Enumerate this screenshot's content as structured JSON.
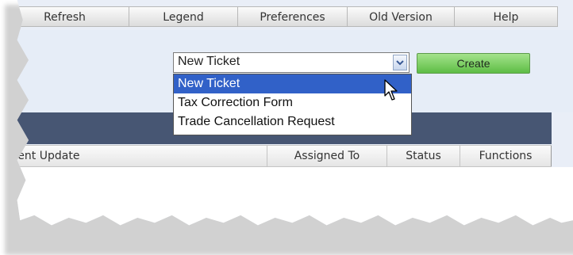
{
  "toolbar": {
    "items": [
      "Refresh",
      "Legend",
      "Preferences",
      "Old Version",
      "Help"
    ]
  },
  "ticket_select": {
    "value": "New Ticket",
    "options": [
      "New Ticket",
      "Tax Correction Form",
      "Trade Cancellation Request"
    ]
  },
  "create_button": "Create",
  "columns": [
    "ecent Update",
    "Assigned To",
    "Status",
    "Functions"
  ],
  "icons": [
    "chevron-down-icon",
    "mouse-cursor-icon"
  ],
  "colors": {
    "create_green": "#5ebd45",
    "selection_blue": "#3161c8",
    "header_bar": "#475673"
  }
}
